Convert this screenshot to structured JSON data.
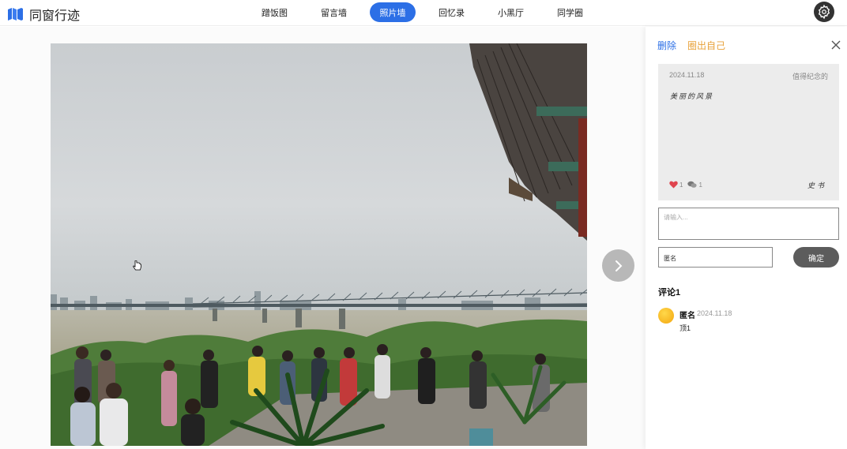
{
  "app": {
    "title": "同窗行迹"
  },
  "nav": {
    "items": [
      {
        "label": "蹭饭图",
        "active": false
      },
      {
        "label": "留言墙",
        "active": false
      },
      {
        "label": "照片墙",
        "active": true
      },
      {
        "label": "回忆录",
        "active": false
      },
      {
        "label": "小黑厅",
        "active": false
      },
      {
        "label": "同学圈",
        "active": false
      }
    ]
  },
  "icons": {
    "logo": "map-icon",
    "settings": "gear-icon",
    "next": "chevron-right-icon",
    "close": "close-icon",
    "like": "heart-icon",
    "comment": "chat-bubble-icon",
    "cursor": "hand-pointer-icon"
  },
  "colors": {
    "accent": "#2c6fe6",
    "highlight": "#e8a23a",
    "like": "#e0454f",
    "confirm": "#5c5c5c"
  },
  "panel": {
    "actions": {
      "delete": "删除",
      "self": "圈出自己"
    },
    "card": {
      "date": "2024.11.18",
      "tag": "值得纪念的",
      "text": "美丽的风景",
      "likes": "1",
      "comments": "1",
      "author": "史书"
    },
    "comment_input": {
      "placeholder": "请输入..."
    },
    "name_input": {
      "value": "匿名"
    },
    "confirm_label": "确定",
    "comments_title": "评论1",
    "comments": [
      {
        "name": "匿名",
        "date": "2024.11.18",
        "body": "顶1"
      }
    ]
  }
}
